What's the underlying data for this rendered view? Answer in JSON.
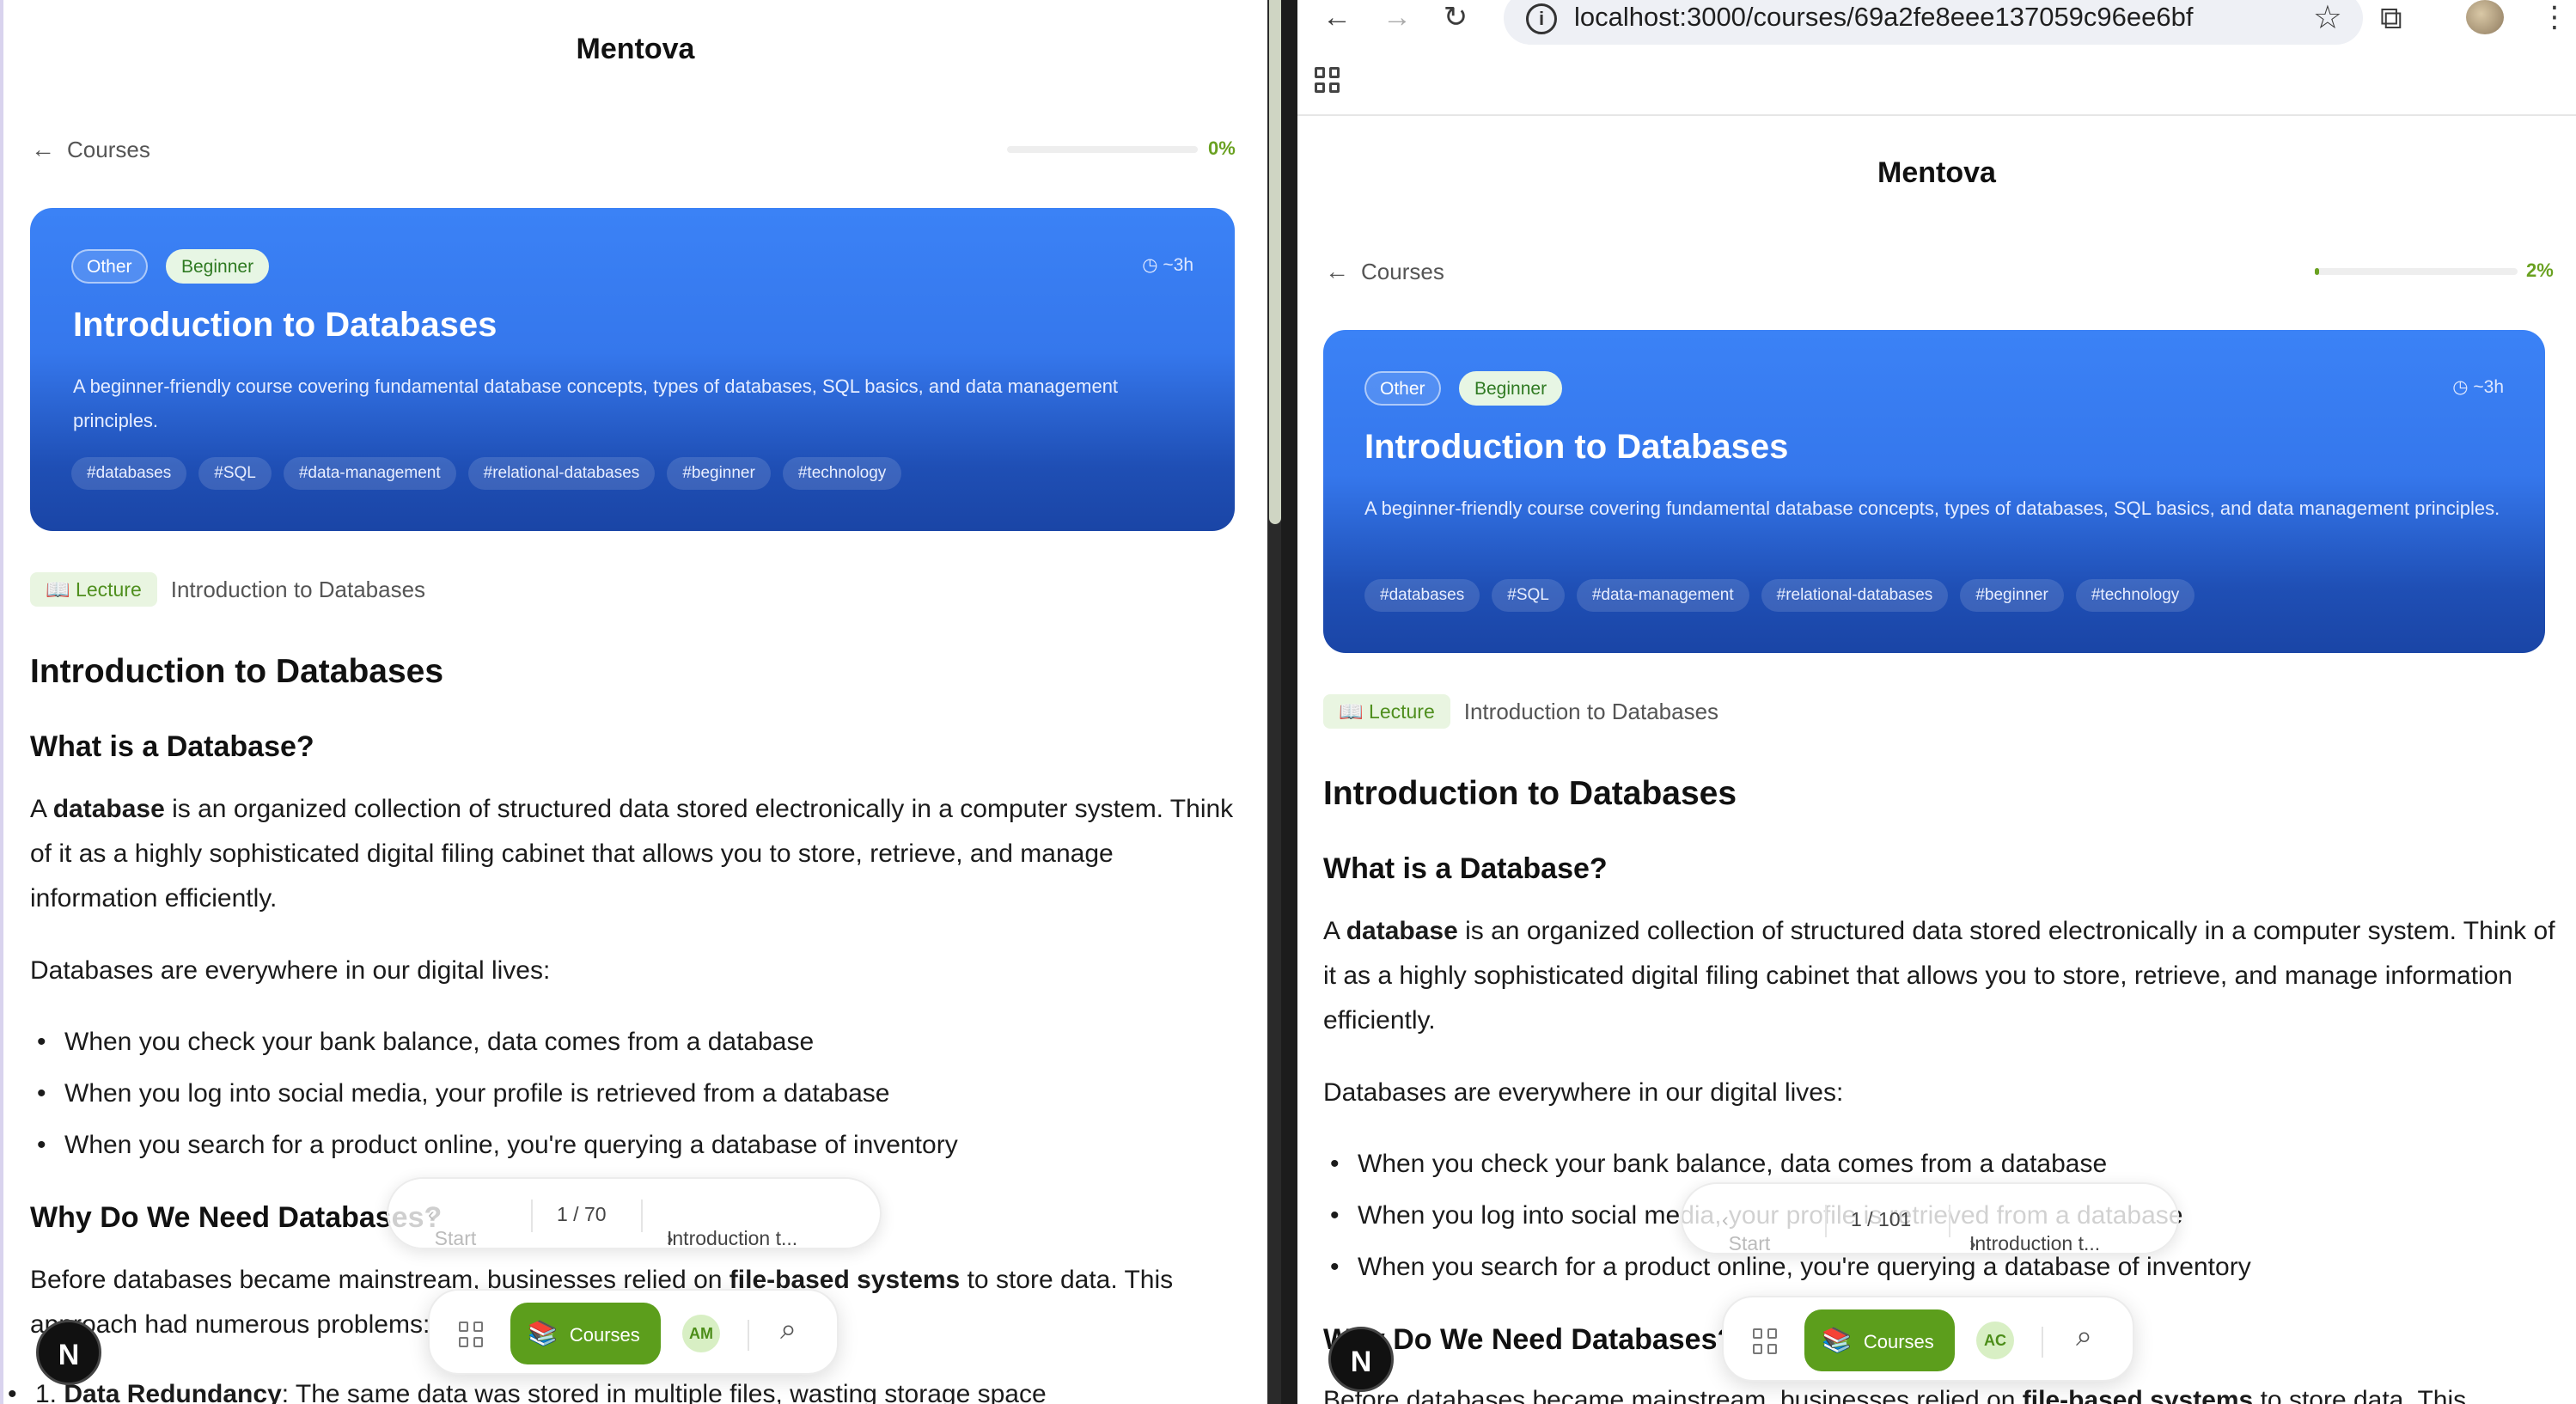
{
  "left": {
    "brand": "Mentova",
    "back_label": "Courses",
    "progress_pct": 0,
    "progress_text": "0%",
    "hero": {
      "category": "Other",
      "level": "Beginner",
      "duration": "~3h",
      "title": "Introduction to Databases",
      "description": "A beginner-friendly course covering fundamental database concepts, types of databases, SQL basics, and data management principles.",
      "tags": [
        "#databases",
        "#SQL",
        "#data-management",
        "#relational-databases",
        "#beginner",
        "#technology"
      ]
    },
    "lecture_badge": "Lecture",
    "lecture_title": "Introduction to Databases",
    "pager": {
      "start": "Start",
      "count": "1 / 70",
      "next": "Introduction t..."
    },
    "dock": {
      "courses": "Courses",
      "avatar": "AM"
    },
    "n_button": "N"
  },
  "right": {
    "url": "localhost:3000/courses/69a2fe8eee137059c96ee6bf",
    "brand": "Mentova",
    "back_label": "Courses",
    "progress_pct": 2,
    "progress_text": "2%",
    "hero": {
      "category": "Other",
      "level": "Beginner",
      "duration": "~3h",
      "title": "Introduction to Databases",
      "description": "A beginner-friendly course covering fundamental database concepts, types of databases, SQL basics, and data management principles.",
      "tags": [
        "#databases",
        "#SQL",
        "#data-management",
        "#relational-databases",
        "#beginner",
        "#technology"
      ]
    },
    "lecture_badge": "Lecture",
    "lecture_title": "Introduction to Databases",
    "pager": {
      "start": "Start",
      "count": "1 / 101",
      "next": "Introduction t..."
    },
    "dock": {
      "courses": "Courses",
      "avatar": "AC"
    },
    "n_button": "N"
  },
  "article": {
    "h1": "Introduction to Databases",
    "h2_what": "What is a Database?",
    "p1_pre": "A ",
    "p1_bold": "database",
    "p1_post": " is an organized collection of structured data stored electronically in a computer system. Think of it as a highly sophisticated digital filing cabinet that allows you to store, retrieve, and manage information efficiently.",
    "p2": "Databases are everywhere in our digital lives:",
    "bullets": [
      "When you check your bank balance, data comes from a database",
      "When you log into social media, your profile is retrieved from a database",
      "When you search for a product online, you're querying a database of inventory"
    ],
    "h2_why": "Why Do We Need Databases?",
    "p3_pre": "Before databases became mainstream, businesses relied on ",
    "p3_bold": "file-based systems",
    "p3_post": " to store data. This approach had numerous problems:",
    "list_item_bold": "Data Redundancy",
    "list_item_rest": ": The same data was stored in multiple files, wasting storage space"
  },
  "colors": {
    "accent_green": "#5c9e1c",
    "hero_blue": "#3b82f6",
    "hero_dark_blue": "#1a45a6"
  }
}
